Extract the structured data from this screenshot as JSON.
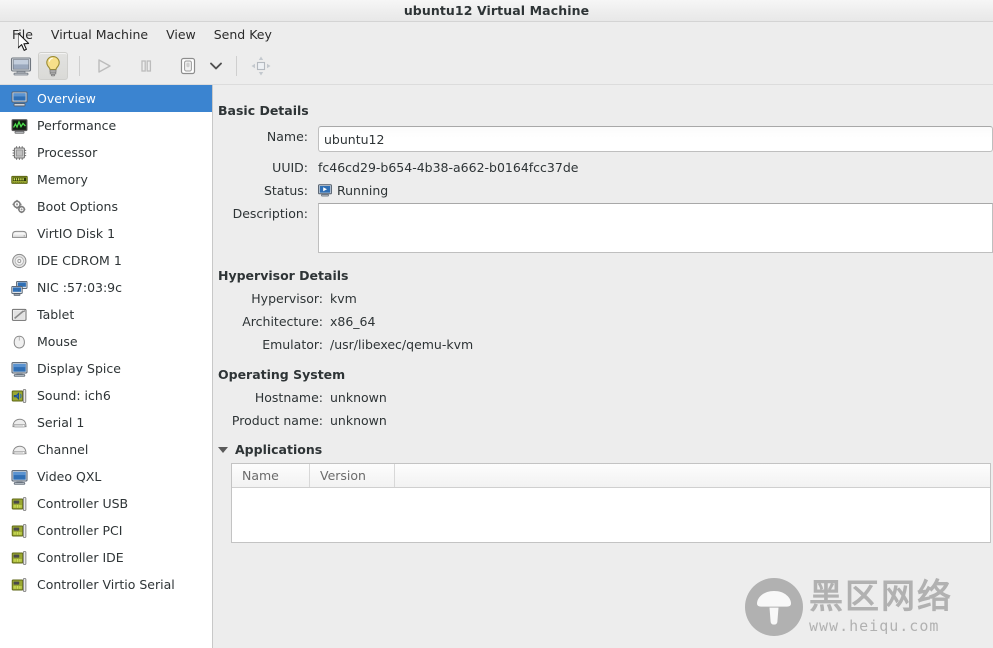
{
  "window": {
    "title": "ubuntu12 Virtual Machine"
  },
  "menubar": {
    "items": [
      {
        "label": "File",
        "name": "menu-file"
      },
      {
        "label": "Virtual Machine",
        "name": "menu-virtual-machine"
      },
      {
        "label": "View",
        "name": "menu-view"
      },
      {
        "label": "Send Key",
        "name": "menu-send-key"
      }
    ]
  },
  "toolbar": {
    "buttons": [
      {
        "name": "show-console-button",
        "icon": "monitor-icon",
        "tooltip": "Console",
        "active": false
      },
      {
        "name": "show-details-button",
        "icon": "lightbulb-icon",
        "tooltip": "Details",
        "active": true
      },
      {
        "name": "run-button",
        "icon": "play-icon",
        "tooltip": "Run",
        "active": false
      },
      {
        "name": "pause-button",
        "icon": "pause-icon",
        "tooltip": "Pause",
        "active": false
      },
      {
        "name": "shutdown-button",
        "icon": "shutdown-icon",
        "tooltip": "Shut Down",
        "active": false
      },
      {
        "name": "shutdown-menu-button",
        "icon": "chevron-down-icon",
        "tooltip": "Shut Down options",
        "active": false
      },
      {
        "name": "fullscreen-button",
        "icon": "fullscreen-icon",
        "tooltip": "Fullscreen",
        "active": false
      }
    ]
  },
  "sidebar": {
    "selected_index": 0,
    "items": [
      {
        "label": "Overview",
        "icon": "monitor-icon"
      },
      {
        "label": "Performance",
        "icon": "performance-graph-icon"
      },
      {
        "label": "Processor",
        "icon": "cpu-chip-icon"
      },
      {
        "label": "Memory",
        "icon": "memory-stick-icon"
      },
      {
        "label": "Boot Options",
        "icon": "gears-icon"
      },
      {
        "label": "VirtIO Disk 1",
        "icon": "harddisk-icon"
      },
      {
        "label": "IDE CDROM 1",
        "icon": "cdrom-disc-icon"
      },
      {
        "label": "NIC :57:03:9c",
        "icon": "network-card-icon"
      },
      {
        "label": "Tablet",
        "icon": "tablet-pen-icon"
      },
      {
        "label": "Mouse",
        "icon": "mouse-icon"
      },
      {
        "label": "Display Spice",
        "icon": "display-icon"
      },
      {
        "label": "Sound: ich6",
        "icon": "sound-card-icon"
      },
      {
        "label": "Serial 1",
        "icon": "serial-port-icon"
      },
      {
        "label": "Channel",
        "icon": "serial-port-icon"
      },
      {
        "label": "Video QXL",
        "icon": "display-icon"
      },
      {
        "label": "Controller USB",
        "icon": "controller-card-icon"
      },
      {
        "label": "Controller PCI",
        "icon": "controller-card-icon"
      },
      {
        "label": "Controller IDE",
        "icon": "controller-card-icon"
      },
      {
        "label": "Controller Virtio Serial",
        "icon": "controller-card-icon"
      }
    ]
  },
  "main": {
    "basic_details": {
      "heading": "Basic Details",
      "name_label": "Name:",
      "name_value": "ubuntu12",
      "uuid_label": "UUID:",
      "uuid_value": "fc46cd29-b654-4b38-a662-b0164fcc37de",
      "status_label": "Status:",
      "status_value": "Running",
      "status_icon": "running-monitor-icon",
      "description_label": "Description:",
      "description_value": ""
    },
    "hypervisor_details": {
      "heading": "Hypervisor Details",
      "rows": [
        {
          "label": "Hypervisor:",
          "value": "kvm"
        },
        {
          "label": "Architecture:",
          "value": "x86_64"
        },
        {
          "label": "Emulator:",
          "value": "/usr/libexec/qemu-kvm"
        }
      ]
    },
    "operating_system": {
      "heading": "Operating System",
      "rows": [
        {
          "label": "Hostname:",
          "value": "unknown"
        },
        {
          "label": "Product name:",
          "value": "unknown"
        }
      ]
    },
    "applications": {
      "heading": "Applications",
      "expanded": true,
      "columns": [
        "Name",
        "Version"
      ],
      "rows": []
    }
  },
  "watermark": {
    "logo_icon": "mushroom-logo-icon",
    "text_cn": "黑区网络",
    "text_url": "www.heiqu.com"
  },
  "colors": {
    "selection_blue": "#3b84d0",
    "window_bg": "#ededed",
    "sidebar_bg": "#ffffff",
    "text": "#2e3436"
  }
}
